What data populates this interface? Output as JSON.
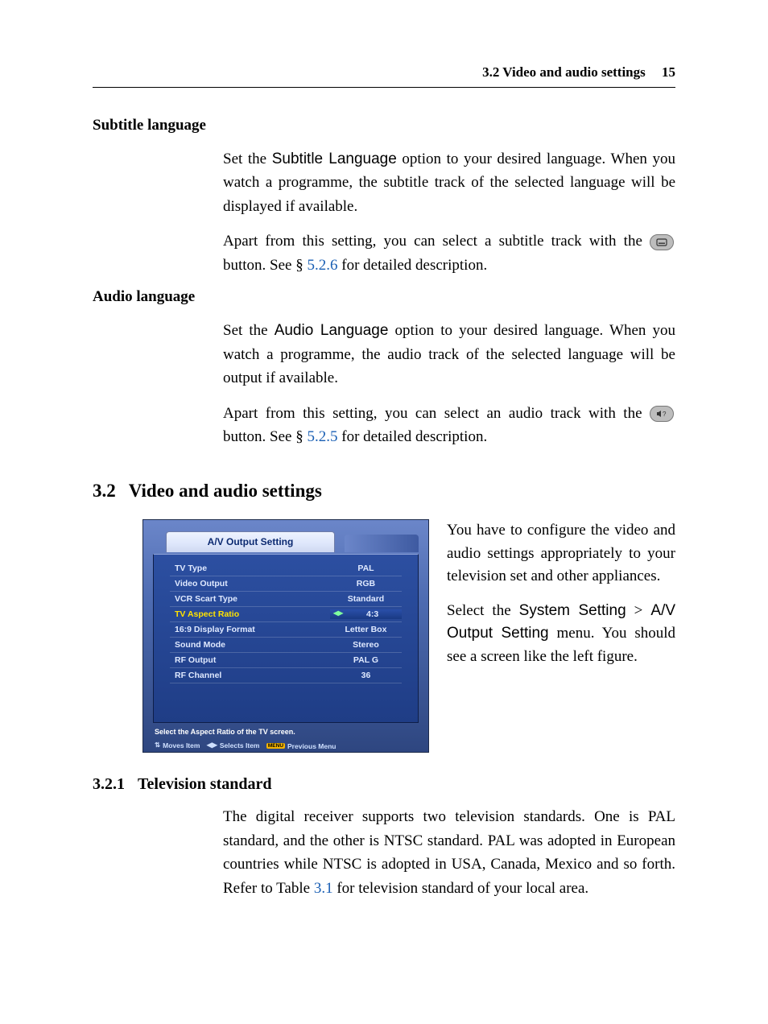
{
  "header": {
    "title": "3.2 Video and audio settings",
    "page_number": "15"
  },
  "sub_lang": {
    "heading": "Subtitle language",
    "p1a": "Set the ",
    "option": "Subtitle Language",
    "p1b": " option to your desired language. When you watch a programme, the subtitle track of the selected language will be displayed if available.",
    "p2a": "Apart from this setting, you can select a subtitle track with the ",
    "p2b": " button. See § ",
    "ref": "5.2.6",
    "p2c": " for detailed description."
  },
  "aud_lang": {
    "heading": "Audio language",
    "p1a": "Set the ",
    "option": "Audio Language",
    "p1b": " option to your desired language. When you watch a programme, the audio track of the selected language will be output if available.",
    "p2a": "Apart from this setting, you can select an audio track with the ",
    "p2b": " button. See § ",
    "ref": "5.2.5",
    "p2c": " for detailed description."
  },
  "section": {
    "num": "3.2",
    "title": "Video and audio settings"
  },
  "fig_text": {
    "p1": "You have to configure the video and audio settings appropriately to your television set and other appliances.",
    "p2a": "Select the ",
    "menu1": "System Setting",
    "gt": " > ",
    "menu2": "A/V Output Setting",
    "p2b": " menu. You should see a screen like the left figure."
  },
  "osd": {
    "title": "A/V Output Setting",
    "rows": [
      {
        "label": "TV Type",
        "value": "PAL"
      },
      {
        "label": "Video Output",
        "value": "RGB"
      },
      {
        "label": "VCR Scart Type",
        "value": "Standard"
      },
      {
        "label": "TV Aspect Ratio",
        "value": "4:3",
        "highlight": true
      },
      {
        "label": "16:9 Display Format",
        "value": "Letter Box"
      },
      {
        "label": "Sound Mode",
        "value": "Stereo"
      },
      {
        "label": "RF Output",
        "value": "PAL G"
      },
      {
        "label": "RF Channel",
        "value": "36"
      }
    ],
    "help": "Select the Aspect Ratio of the TV screen.",
    "footer": {
      "moves": "Moves Item",
      "selects": "Selects Item",
      "menu_badge": "MENU",
      "prev": "Previous Menu"
    }
  },
  "subsection": {
    "num": "3.2.1",
    "title": "Television standard"
  },
  "tv_std": {
    "text_a": "The digital receiver supports two television standards. One is PAL standard, and the other is NTSC standard. PAL was adopted in European countries while NTSC is adopted in USA, Canada, Mexico and so forth. Refer to Table ",
    "ref": "3.1",
    "text_b": " for television standard of your local area."
  }
}
